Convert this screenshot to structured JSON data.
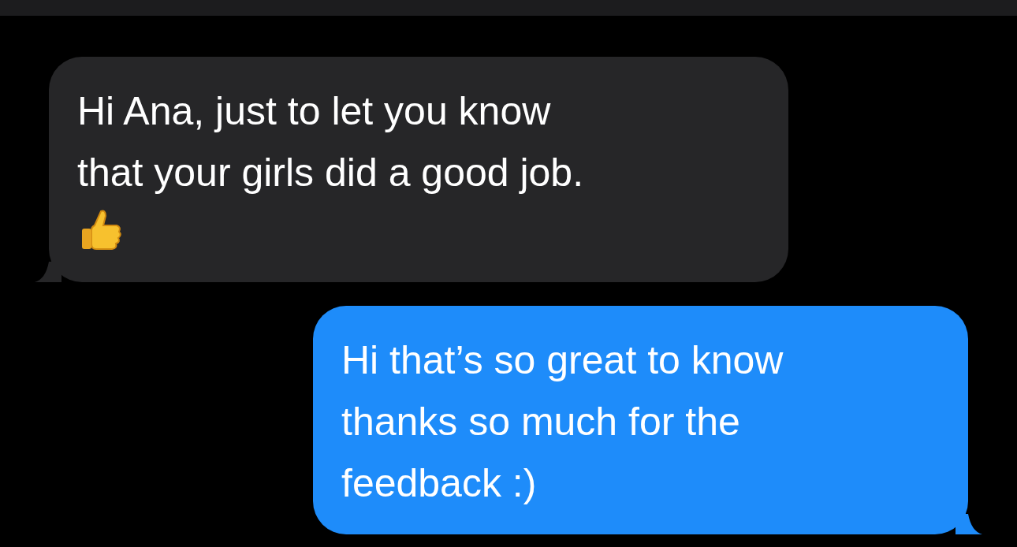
{
  "messages": [
    {
      "kind": "incoming",
      "lines": [
        "Hi Ana, just to let you know",
        "that your girls did a good job."
      ],
      "has_emoji": true
    },
    {
      "kind": "outgoing",
      "lines": [
        "Hi that’s so great to know",
        "thanks so much for the",
        "feedback :)"
      ],
      "has_emoji": false
    }
  ]
}
